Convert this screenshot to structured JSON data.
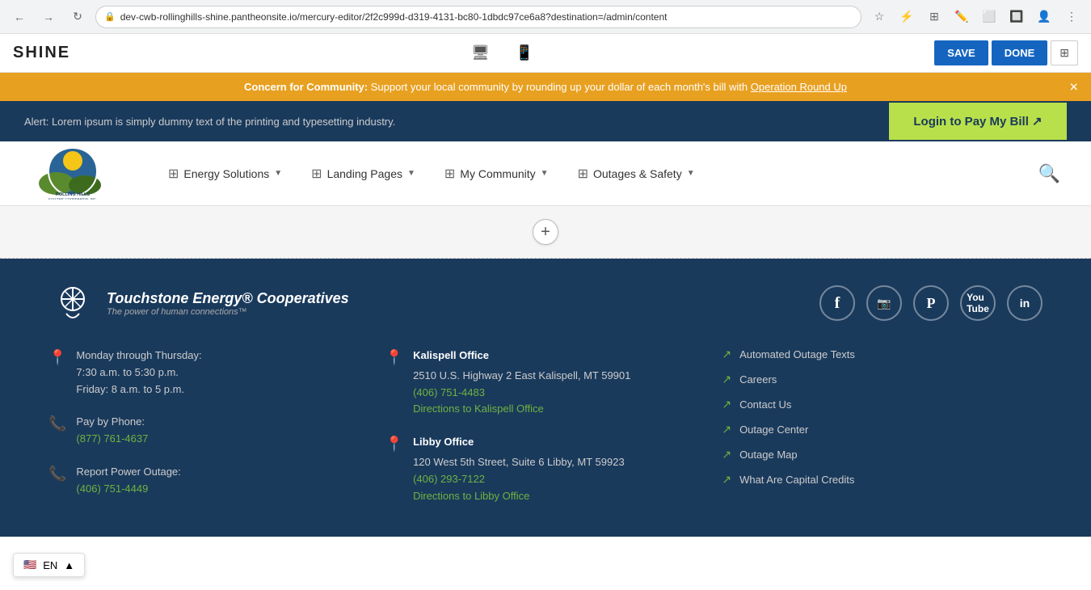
{
  "browser": {
    "url": "dev-cwb-rollinghills-shine.pantheonsite.io/mercury-editor/2f2c999d-d319-4131-bc80-1dbdc97ce6a8?destination=/admin/content",
    "back_title": "back",
    "forward_title": "forward",
    "reload_title": "reload"
  },
  "editor": {
    "logo": "SHINE",
    "save_label": "SAVE",
    "done_label": "DONE",
    "desktop_icon": "🖥",
    "mobile_icon": "📱"
  },
  "banner": {
    "prefix": "Concern for Community:",
    "text": " Support your local community by rounding up your dollar of each month's bill with ",
    "link": "Operation Round Up",
    "close_label": "×"
  },
  "alert": {
    "text": "Alert: Lorem ipsum is simply dummy text of the printing and typesetting industry.",
    "login_label": "Login to Pay My Bill ↗"
  },
  "nav": {
    "items": [
      {
        "id": "energy-solutions",
        "label": "Energy Solutions",
        "has_dropdown": true
      },
      {
        "id": "landing-pages",
        "label": "Landing Pages",
        "has_dropdown": true
      },
      {
        "id": "my-community",
        "label": "My Community",
        "has_dropdown": true
      },
      {
        "id": "outages-safety",
        "label": "Outages & Safety",
        "has_dropdown": true
      }
    ],
    "search_label": "search"
  },
  "content_area": {
    "add_label": "+"
  },
  "footer": {
    "touchstone_name": "Touchstone Energy® Cooperatives",
    "touchstone_tagline": "The power of human connections™",
    "social": [
      {
        "id": "facebook",
        "icon": "f",
        "label": "Facebook"
      },
      {
        "id": "instagram",
        "icon": "📷",
        "label": "Instagram"
      },
      {
        "id": "pinterest",
        "icon": "P",
        "label": "Pinterest"
      },
      {
        "id": "youtube",
        "icon": "▶",
        "label": "YouTube"
      },
      {
        "id": "linkedin",
        "icon": "in",
        "label": "LinkedIn"
      }
    ],
    "hours": {
      "icon": "📍",
      "line1": "Monday through Thursday:",
      "line2": "7:30 a.m. to 5:30 p.m.",
      "line3": "Friday: 8 a.m. to 5 p.m."
    },
    "pay_phone": {
      "icon": "📞",
      "label": "Pay by Phone:",
      "number": "(877) 761-4637"
    },
    "report_outage": {
      "icon": "📞",
      "label": "Report Power Outage:",
      "number": "(406) 751-4449"
    },
    "kalispell": {
      "icon": "📍",
      "name": "Kalispell Office",
      "address": "2510 U.S. Highway 2 East Kalispell, MT 59901",
      "phone": "(406) 751-4483",
      "directions": "Directions to Kalispell Office"
    },
    "libby": {
      "icon": "📍",
      "name": "Libby Office",
      "address": "120 West 5th Street, Suite 6 Libby, MT 59923",
      "phone": "(406) 293-7122",
      "directions": "Directions to Libby Office"
    },
    "links": [
      "Automated Outage Texts",
      "Careers",
      "Contact Us",
      "Outage Center",
      "Outage Map",
      "What Are Capital Credits"
    ]
  },
  "lang": {
    "flag": "🇺🇸",
    "code": "EN",
    "chevron": "▲"
  }
}
